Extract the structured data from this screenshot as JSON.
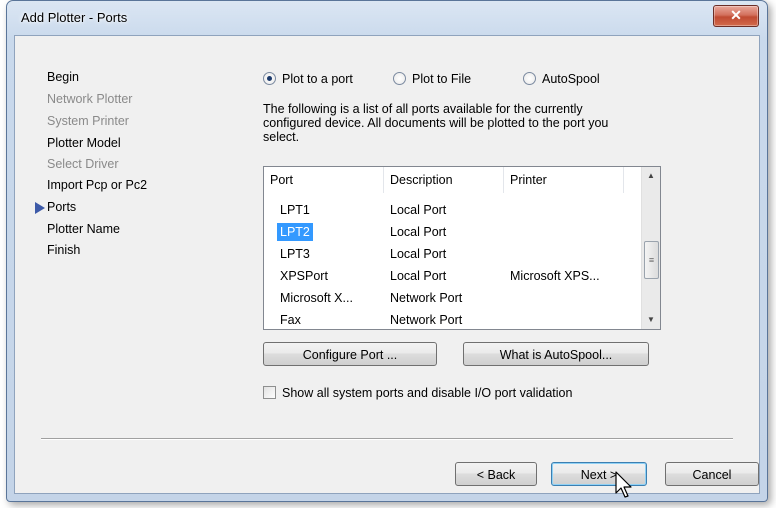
{
  "window": {
    "title": "Add Plotter - Ports",
    "close_icon": "x-icon"
  },
  "nav": {
    "items": [
      {
        "label": "Begin",
        "disabled": false
      },
      {
        "label": "Network Plotter",
        "disabled": true
      },
      {
        "label": "System Printer",
        "disabled": true
      },
      {
        "label": "Plotter Model",
        "disabled": false
      },
      {
        "label": "Select Driver",
        "disabled": true
      },
      {
        "label": "Import Pcp or Pc2",
        "disabled": false
      },
      {
        "label": "Ports",
        "disabled": false,
        "current": true
      },
      {
        "label": "Plotter Name",
        "disabled": false
      },
      {
        "label": "Finish",
        "disabled": false
      }
    ]
  },
  "options": {
    "plot_to_port": "Plot to a port",
    "plot_to_file": "Plot to File",
    "autospool": "AutoSpool",
    "selected": "Plot to a port"
  },
  "description": "The following is a list of all ports available for the currently configured device. All documents will be plotted to the port you select.",
  "ports": {
    "columns": [
      "Port",
      "Description",
      "Printer"
    ],
    "rows": [
      [
        "LPT1",
        "Local Port",
        ""
      ],
      [
        "LPT2",
        "Local Port",
        ""
      ],
      [
        "LPT3",
        "Local Port",
        ""
      ],
      [
        "XPSPort",
        "Local Port",
        "Microsoft XPS..."
      ],
      [
        "Microsoft X...",
        "Network Port",
        ""
      ],
      [
        "Fax",
        "Network Port",
        ""
      ]
    ],
    "selected_port": "LPT2"
  },
  "buttons": {
    "configure_port": "Configure Port ...",
    "what_is_autospool": "What is AutoSpool...",
    "back": "< Back",
    "next": "Next >",
    "cancel": "Cancel"
  },
  "checkbox": {
    "label": "Show all system ports and disable I/O port validation",
    "checked": false
  }
}
